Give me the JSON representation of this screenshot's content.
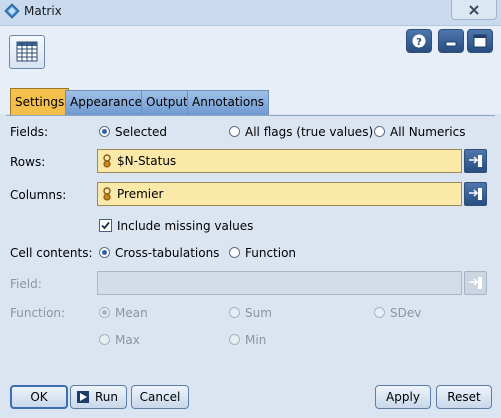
{
  "window": {
    "title": "Matrix"
  },
  "tabs": [
    {
      "label": "Settings",
      "active": true
    },
    {
      "label": "Appearance",
      "active": false
    },
    {
      "label": "Output",
      "active": false
    },
    {
      "label": "Annotations",
      "active": false
    }
  ],
  "settings": {
    "fields_label": "Fields:",
    "fields_options": [
      {
        "label": "Selected",
        "selected": true
      },
      {
        "label": "All flags (true values)",
        "selected": false
      },
      {
        "label": "All Numerics",
        "selected": false
      }
    ],
    "rows_label": "Rows:",
    "rows_value": "$N-Status",
    "columns_label": "Columns:",
    "columns_value": "Premier",
    "include_missing_label": "Include missing values",
    "include_missing_checked": true,
    "cell_contents_label": "Cell contents:",
    "cell_contents_options": [
      {
        "label": "Cross-tabulations",
        "selected": true
      },
      {
        "label": "Function",
        "selected": false
      }
    ],
    "field_label": "Field:",
    "field_value": "",
    "function_label": "Function:",
    "function_options": [
      {
        "label": "Mean",
        "selected": true
      },
      {
        "label": "Sum",
        "selected": false
      },
      {
        "label": "SDev",
        "selected": false
      },
      {
        "label": "Max",
        "selected": false
      },
      {
        "label": "Min",
        "selected": false
      }
    ]
  },
  "footer": {
    "ok": "OK",
    "run": "Run",
    "cancel": "Cancel",
    "apply": "Apply",
    "reset": "Reset"
  },
  "colors": {
    "active_tab": "#f4c04b",
    "field_bg": "#fae9a9",
    "accent_blue": "#274d82"
  }
}
